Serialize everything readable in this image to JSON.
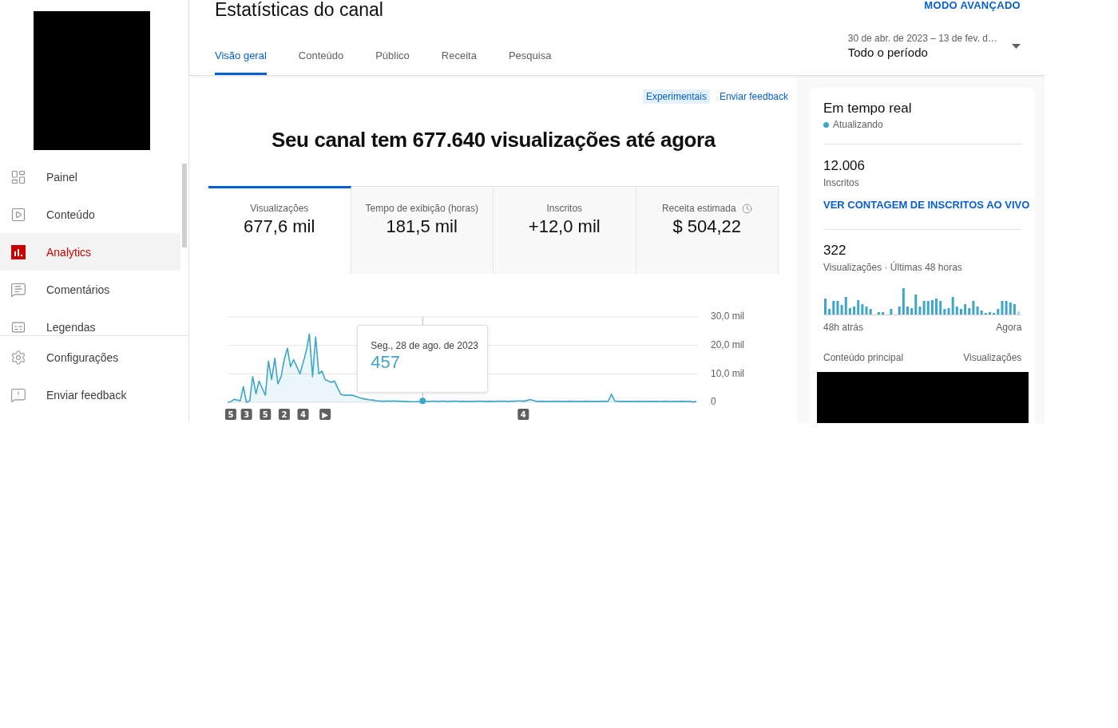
{
  "sidebar": {
    "nav_items": [
      {
        "label": "Painel",
        "selected": false
      },
      {
        "label": "Conteúdo",
        "selected": false
      },
      {
        "label": "Analytics",
        "selected": true
      },
      {
        "label": "Comentários",
        "selected": false
      },
      {
        "label": "Legendas",
        "selected": false
      }
    ],
    "footer_items": [
      {
        "label": "Configurações"
      },
      {
        "label": "Enviar feedback"
      }
    ]
  },
  "header": {
    "title": "Estatísticas do canal",
    "advanced_mode": "MODO AVANÇADO",
    "tabs": [
      {
        "label": "Visão geral",
        "selected": true
      },
      {
        "label": "Conteúdo",
        "selected": false
      },
      {
        "label": "Público",
        "selected": false
      },
      {
        "label": "Receita",
        "selected": false
      },
      {
        "label": "Pesquisa",
        "selected": false
      }
    ],
    "date_range": {
      "range": "30 de abr. de 2023 – 13 de fev. d…",
      "period": "Todo o período"
    }
  },
  "overview": {
    "badge": "Experimentais",
    "feedback_link": "Enviar feedback",
    "headline": "Seu canal tem 677.640 visualizações até agora",
    "metrics": [
      {
        "kind": "plain",
        "label": "Visualizações",
        "value": "677,6 mil",
        "selected": true
      },
      {
        "kind": "plain",
        "label": "Tempo de exibição (horas)",
        "value": "181,5 mil",
        "selected": false
      },
      {
        "kind": "plain",
        "label": "Inscritos",
        "value": "+12,0 mil",
        "selected": false
      },
      {
        "kind": "delayed",
        "label": "Receita estimada",
        "value": "$ 504,22",
        "selected": false
      }
    ],
    "chart": {
      "chart_data": {
        "type": "area",
        "ylim": [
          0,
          30
        ],
        "yticks": [
          {
            "value": 0,
            "label": "0"
          },
          {
            "value": 10,
            "label": "10,0 mil"
          },
          {
            "value": 20,
            "label": "20,0 mil"
          },
          {
            "value": 30,
            "label": "30,0 mil"
          }
        ],
        "series": [
          {
            "color": "#3ea6c9",
            "values": [
              0,
              0.2,
              1,
              0.8,
              0.5,
              5.5,
              0,
              0.5,
              9,
              3,
              7.5,
              5,
              2.5,
              14.5,
              8,
              15.5,
              6.5,
              9,
              15,
              19,
              12.5,
              15,
              12.5,
              10,
              14,
              18,
              24,
              9,
              23,
              10,
              11,
              8,
              7.5,
              7,
              7.5,
              5,
              2.8,
              2.5,
              2.5,
              2.5,
              2.4,
              2,
              1.6,
              1.3,
              1.1,
              0.9,
              0.8,
              0.6,
              0.5,
              0.4,
              0.4,
              0.5,
              0.4,
              0.5,
              0.4,
              0.4,
              0.3,
              0.3,
              0.2,
              0.2,
              0.2,
              0.3,
              0.5,
              0.4,
              0.3,
              0.4,
              0.4,
              0.3,
              0.4,
              0.4,
              0.3,
              0.4,
              0.4,
              0.4,
              0.3,
              0.4,
              0.3,
              0.3,
              0.3,
              0.4,
              0.4,
              0.4,
              0.3,
              0.4,
              0.3,
              0.3,
              0.4,
              0.4,
              0.4,
              0.3,
              0.4,
              0.4,
              0.5,
              0.5,
              0.4,
              0.6,
              1,
              0.7,
              0.4,
              0.3,
              0.4,
              0.3,
              0.3,
              0.3,
              0.4,
              0.3,
              0.3,
              0.3,
              0.3,
              0.4,
              0.3,
              0.3,
              0.3,
              0.3,
              0.4,
              0.3,
              0.3,
              0.3,
              0.3,
              0.4,
              0.3,
              0.4,
              2.9,
              0.5,
              0.3,
              0.3,
              0.3,
              0.3,
              0.3,
              0.3,
              0.3,
              0.4,
              0.3,
              0.3,
              0.3,
              0.3,
              0.3,
              0.3,
              0.3,
              0.4,
              0.3,
              0.3,
              0.3,
              0.3,
              0.4,
              0.3,
              0.3,
              0.3,
              0.1,
              0.3
            ]
          }
        ]
      },
      "tooltip": {
        "date": "Seg., 28 de ago. de 2023",
        "value": "457"
      },
      "markers": [
        {
          "label": "5"
        },
        {
          "label": "3"
        },
        {
          "label": "5"
        },
        {
          "label": "2"
        },
        {
          "label": "4"
        },
        {
          "label": "▶"
        },
        {
          "label": "4"
        }
      ]
    }
  },
  "realtime": {
    "title": "Em tempo real",
    "status": "Atualizando",
    "subscribers": {
      "value": "12.006",
      "label": "Inscritos",
      "link": "VER CONTAGEM DE INSCRITOS AO VIVO"
    },
    "views": {
      "value": "322",
      "label": "Visualizações · Últimas 48 horas",
      "axis_start": "48h atrás",
      "axis_end": "Agora"
    },
    "top_content": {
      "heading": "Conteúdo principal",
      "metric": "Visualizações"
    }
  }
}
